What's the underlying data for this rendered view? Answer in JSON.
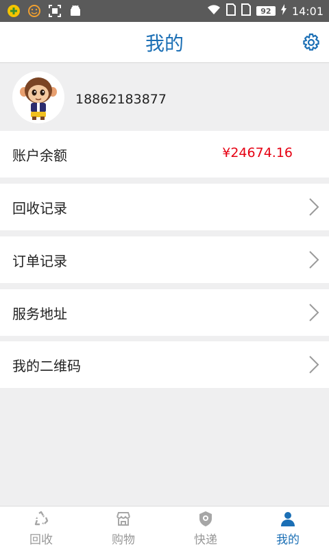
{
  "status_bar": {
    "battery": "92",
    "time": "14:01"
  },
  "header": {
    "title": "我的"
  },
  "profile": {
    "phone": "18862183877"
  },
  "balance": {
    "label": "账户余额",
    "value": "¥24674.16"
  },
  "menu": [
    {
      "label": "回收记录"
    },
    {
      "label": "订单记录"
    },
    {
      "label": "服务地址"
    },
    {
      "label": "我的二维码"
    }
  ],
  "tabs": [
    {
      "label": "回收",
      "icon": "recycle-icon"
    },
    {
      "label": "购物",
      "icon": "shop-icon"
    },
    {
      "label": "快递",
      "icon": "shield-icon"
    },
    {
      "label": "我的",
      "icon": "user-icon",
      "active": true
    }
  ],
  "colors": {
    "accent": "#1b6fb5",
    "price": "#e60012",
    "inactive": "#999999"
  }
}
